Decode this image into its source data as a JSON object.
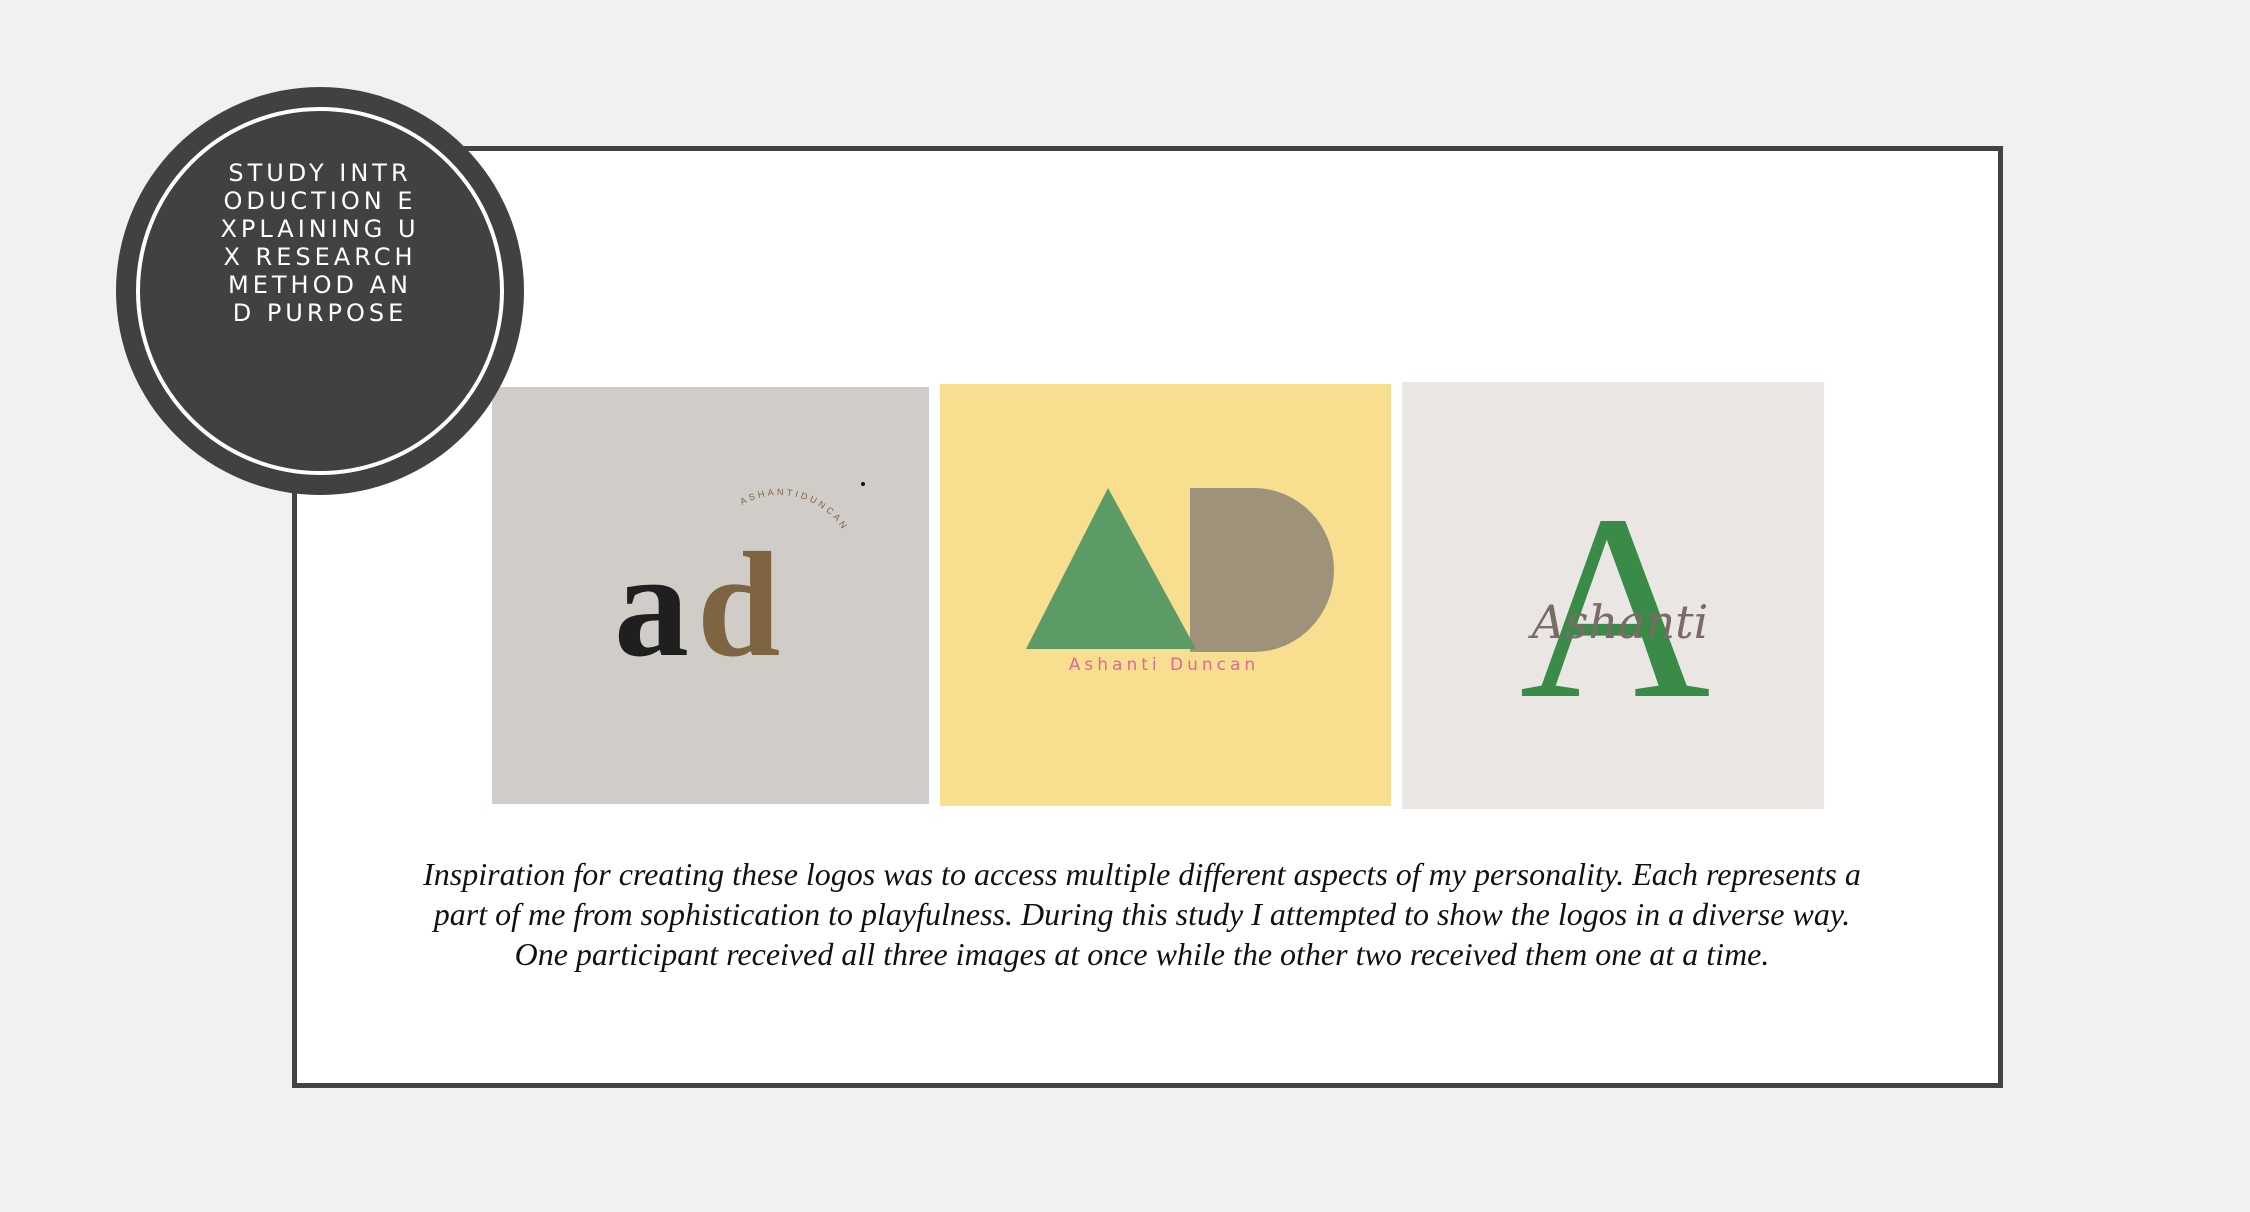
{
  "badge": {
    "text": "STUDY INTRODUCTION EXPLAINING UX RESEARCH METHOD AND PURPOSE"
  },
  "logos": [
    {
      "letters_a": "a",
      "letters_d": "d",
      "arc_text": "ASHANTIDUNCAN",
      "background": "#d0cdc9",
      "letter_color_dark": "#1f1f1f",
      "letter_color_brown": "#7e6440"
    },
    {
      "name_text": "Ashanti Duncan",
      "background": "#f8df8f",
      "triangle_color": "#5c9a66",
      "d_color": "#9e927a",
      "name_color": "#e0679b"
    },
    {
      "letter": "A",
      "script_text": "Ashanti",
      "background": "#e9e6e3",
      "letter_color": "#3a8a48",
      "script_color": "#7a6b66"
    }
  ],
  "caption": "Inspiration for creating these logos was to access multiple different aspects of my personality. Each represents a part of me from sophistication to playfulness. During this study I attempted to show the logos in a diverse way. One participant received all three images at once while the other two received them one at a time."
}
